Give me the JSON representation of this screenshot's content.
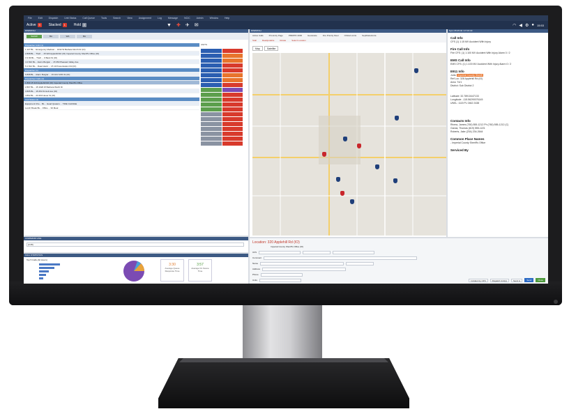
{
  "statusbar": {
    "active_label": "Active",
    "active_count": "9",
    "stacked_label": "Stacked",
    "stacked_count": "1",
    "hold_label": "Hold",
    "hold_count": "0",
    "clock": "15:53"
  },
  "tabs": [
    "SHOW",
    "BA",
    "WA",
    "BA"
  ],
  "incidents": [
    {
      "text": "Dispatcher CAD (1)",
      "type": "hdr"
    },
    {
      "text": "1 127 BL... Emergency Medical ... 1632 W Barbara Worth Dr (IO)",
      "type": "row"
    },
    {
      "text": "2 808 BL... Theft ... 15 320 Applehill Rd (IO) Imperial County Sheriff's Office (IO)",
      "type": "alt"
    },
    {
      "text": "3 3 93 BL... Theft ... 0 Bank St (IO)",
      "type": "row"
    },
    {
      "text": "4 2 810 BL... Alarm Burglar ... 15 350 Pleasant Valley Ave",
      "type": "alt"
    },
    {
      "text": "5 2 812 BL... Road Hazd ... 15 10 Powerstation Rd (IO)",
      "type": "row"
    },
    {
      "text": "Dispatcher (1)",
      "type": "hdr"
    },
    {
      "text": "6 808 BL... Alarm Burglar ... 15 164 S 8th St (IO)",
      "type": "alt"
    },
    {
      "text": "Dispatched Calls (4)",
      "type": "hdr"
    },
    {
      "text": "1 809 15 320 Applehill Rd (IO) Imperial County Sheriff's Office",
      "type": "sel"
    },
    {
      "text": "2 807 BL... 15 1920 W Barbara Worth Dr",
      "type": "row"
    },
    {
      "text": "3 805 BL... 15 254 W Holt Ave (IO)",
      "type": "alt"
    },
    {
      "text": "4 802 BL... 23 263 Heuer St (IO)",
      "type": "row"
    },
    {
      "text": "Unit Status (2)",
      "type": "hdr"
    },
    {
      "text": "Equipment Che... BL... Head Quaters ... TIRE CHANGE",
      "type": "alt"
    },
    {
      "text": "Lunch Break BL... Office ... 93 Meal",
      "type": "row"
    }
  ],
  "units_header": "UNITS",
  "panels": {
    "incidents": "DISPATCH",
    "map": "DISPATCH",
    "command": "COMMAND LINE",
    "stats": "CALL STATISTICS",
    "info": "Sync 05:25:40 / 07:15:33"
  },
  "command_value": "[4:28]",
  "stats": {
    "chart_title": "Top 5 Calls (All Hours)",
    "box1_value": "3:30",
    "box1_label": "Average Queue Response Time",
    "box2_value": "3:57",
    "box2_label": "Average On Scene Time"
  },
  "map": {
    "tabs": [
      "Active Calls",
      "Proximity Page",
      "PMR/PD 4000",
      "Geolocate",
      "Fire Priority Fleet",
      "Orbital Limits",
      "SeptData Extra"
    ],
    "view_map": "Map",
    "view_sat": "Satellite",
    "tools": [
      "Stall",
      "Readjustable",
      "Rotate",
      "Select Location"
    ]
  },
  "info": {
    "call_info_title": "Call Info",
    "call_info_text": "CFS (1) 1:15 MV Accident With Injury",
    "fire_title": "Fire Call Info",
    "fire_text": "Fire CFS: (1) 1:100 MV Accident With Injury Alarm 0 / 2",
    "ems_title": "EMS Call Info",
    "ems_text": "EMS CFS: (1) 1:100 MV Accident With Injury Alarm 0 / 2",
    "e911_title": "E911 Info",
    "e911_juris": "Imperial County Sheriff",
    "e911_lines": [
      "Juris:",
      "Ref Loc: 328 Applehill Rd (IO)",
      "Area: T4/1",
      "District: Sub District 2"
    ],
    "coords": [
      "Latitude: 32.78913447133",
      "Longitude: -115.56290076145",
      "UNKL: 1115 PL 0462 2438"
    ],
    "contacts_title": "Contacts Info",
    "contacts_lines": [
      "Rivera, James (760) 555-1212 Ph (760) 555-1212 (C)",
      "Garcia, Thomas (619) 555-1221",
      "Roberts, Jake (234) 234-2644"
    ],
    "common_title": "Common Place Names",
    "common_text": "- Imperial County Sheriff's Office",
    "serviced_title": "Serviced By"
  },
  "form": {
    "location": "Location: 320 Applehill Rd (IO)",
    "sub": "Imperial County Sheriff's Office (IO)",
    "labels": [
      "CFS",
      "Comment",
      "Name",
      "Address",
      "Phone",
      "Units"
    ],
    "buttons": [
      "Incident by CFS",
      "Dispatch Unit(s)",
      "Send to"
    ],
    "send": "Send",
    "close": "Close"
  }
}
